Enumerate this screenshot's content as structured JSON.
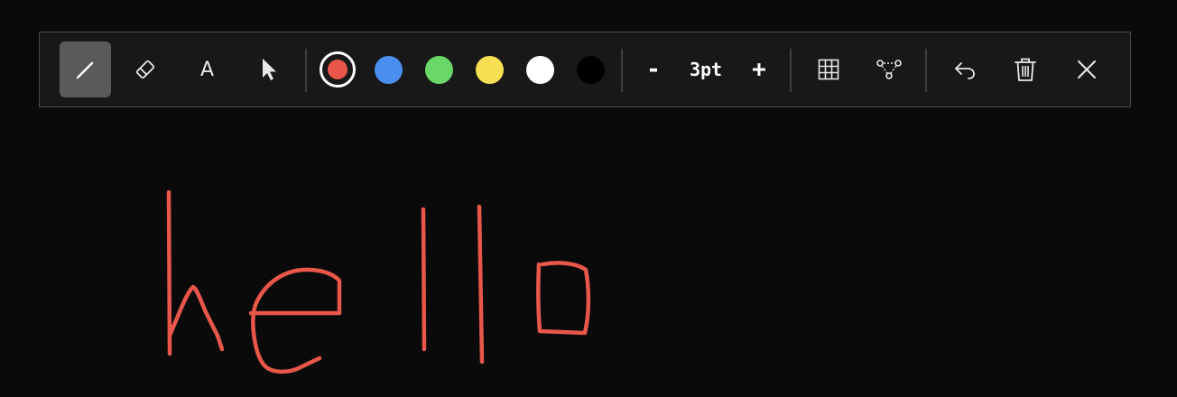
{
  "toolbar": {
    "tools": [
      {
        "name": "pen",
        "icon": "pen-icon",
        "active": true
      },
      {
        "name": "eraser",
        "icon": "eraser-icon",
        "active": false
      },
      {
        "name": "text",
        "icon": "text-icon",
        "label": "A",
        "active": false
      },
      {
        "name": "select",
        "icon": "cursor-arrow-icon",
        "active": false
      }
    ],
    "colors": [
      {
        "name": "red",
        "hex": "#e8574a",
        "selected": true
      },
      {
        "name": "blue",
        "hex": "#4a8ff0",
        "selected": false
      },
      {
        "name": "green",
        "hex": "#6bd768",
        "selected": false
      },
      {
        "name": "yellow",
        "hex": "#f6df52",
        "selected": false
      },
      {
        "name": "white",
        "hex": "#ffffff",
        "selected": false
      },
      {
        "name": "black",
        "hex": "#000000",
        "selected": false
      }
    ],
    "stroke_size": {
      "decrease_label": "-",
      "value_label": "3pt",
      "increase_label": "+"
    },
    "actions": [
      {
        "name": "grid",
        "icon": "grid-icon"
      },
      {
        "name": "shape-nodes",
        "icon": "nodes-icon"
      },
      {
        "name": "undo",
        "icon": "undo-icon"
      },
      {
        "name": "clear",
        "icon": "trash-icon"
      },
      {
        "name": "close",
        "icon": "close-icon"
      }
    ]
  },
  "canvas": {
    "background": "#0a0a0a",
    "ink_color": "#e8574a",
    "handwritten_text": "hello"
  }
}
